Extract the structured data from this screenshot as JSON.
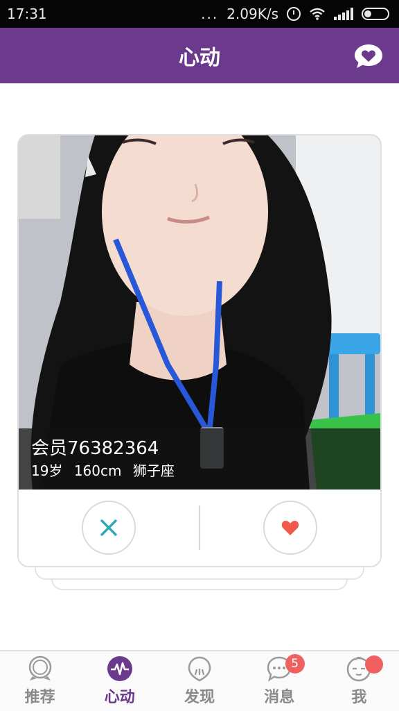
{
  "status_bar": {
    "time": "17:31",
    "dots": "...",
    "net_speed": "2.09K/s"
  },
  "header": {
    "title": "心动",
    "chat_icon": "chat-heart-icon"
  },
  "card": {
    "member_name": "会员76382364",
    "age": "19岁",
    "height": "160cm",
    "zodiac": "狮子座",
    "reject_icon": "close-icon",
    "like_icon": "heart-icon",
    "colors": {
      "reject": "#2aa9b4",
      "like": "#ef5a4a"
    }
  },
  "tabs": [
    {
      "label": "推荐",
      "icon": "recommend-icon"
    },
    {
      "label": "心动",
      "icon": "heartbeat-icon",
      "active": true
    },
    {
      "label": "发现",
      "icon": "discover-icon"
    },
    {
      "label": "消息",
      "icon": "message-icon",
      "badge": "5"
    },
    {
      "label": "我",
      "icon": "profile-icon"
    }
  ],
  "colors": {
    "brand": "#6b3a8c",
    "badge": "#f06060"
  }
}
